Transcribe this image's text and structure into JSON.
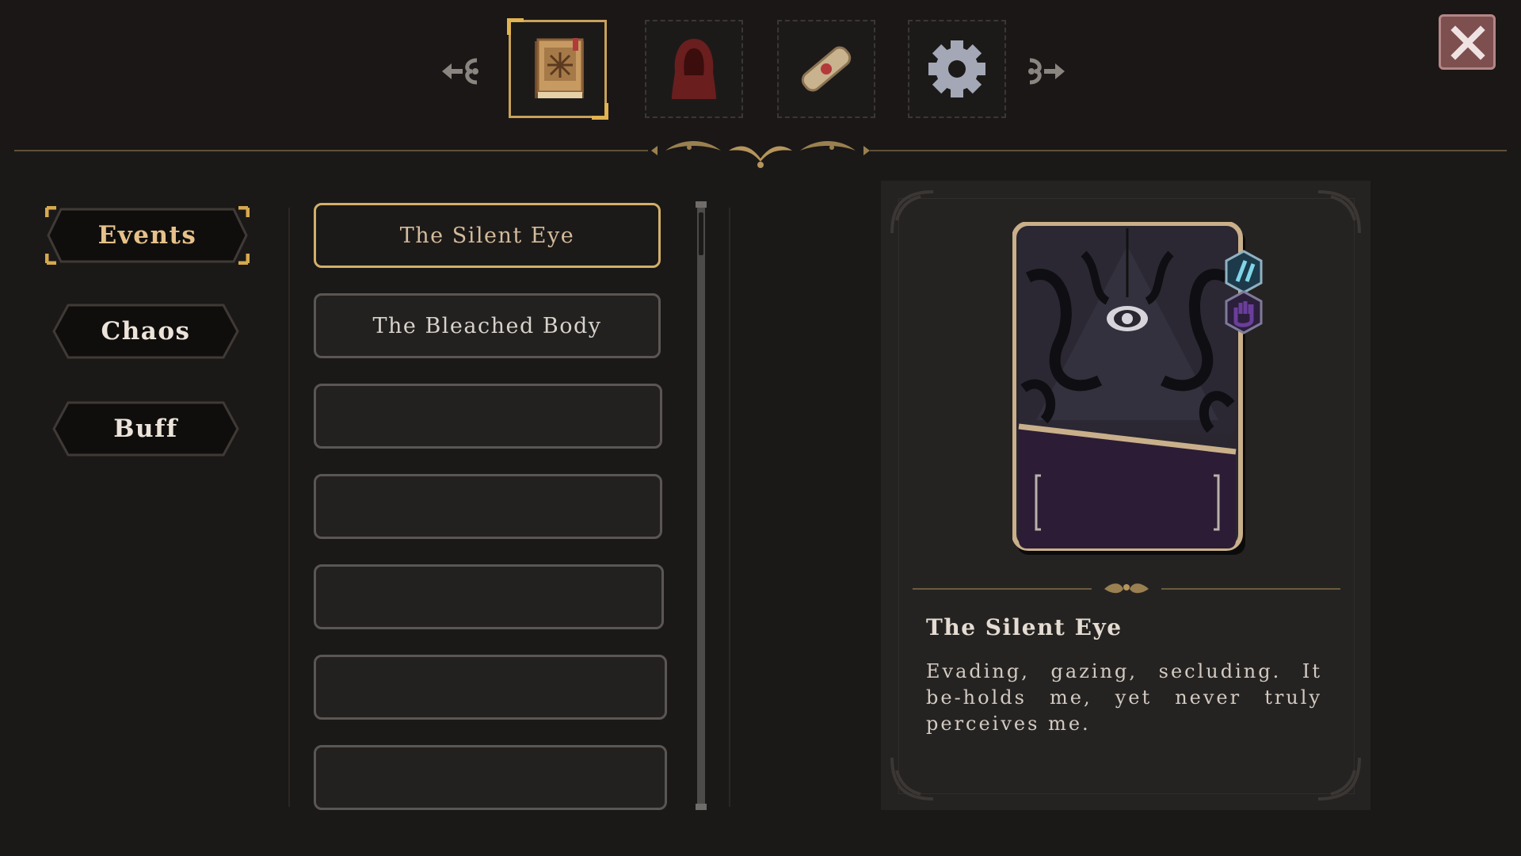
{
  "tabs": [
    {
      "name": "journal-book-icon",
      "active": true
    },
    {
      "name": "hooded-figure-icon",
      "active": false
    },
    {
      "name": "scroll-icon",
      "active": false
    },
    {
      "name": "gear-icon",
      "active": false
    }
  ],
  "categories": [
    {
      "label": "Events",
      "active": true
    },
    {
      "label": "Chaos",
      "active": false
    },
    {
      "label": "Buff",
      "active": false
    }
  ],
  "list": {
    "items": [
      {
        "label": "The Silent Eye",
        "selected": true
      },
      {
        "label": "The Bleached Body",
        "selected": false
      },
      {
        "label": "",
        "selected": false
      },
      {
        "label": "",
        "selected": false
      },
      {
        "label": "",
        "selected": false
      },
      {
        "label": "",
        "selected": false
      },
      {
        "label": "",
        "selected": false
      }
    ]
  },
  "detail": {
    "title": "The Silent Eye",
    "description": "Evading, gazing, secluding. It be-holds me, yet never truly perceives me."
  },
  "colors": {
    "accent_gold": "#d2b06a",
    "background": "#1b1918",
    "close_button": "#7e4f4f",
    "card_frame": "#c9b08a"
  }
}
